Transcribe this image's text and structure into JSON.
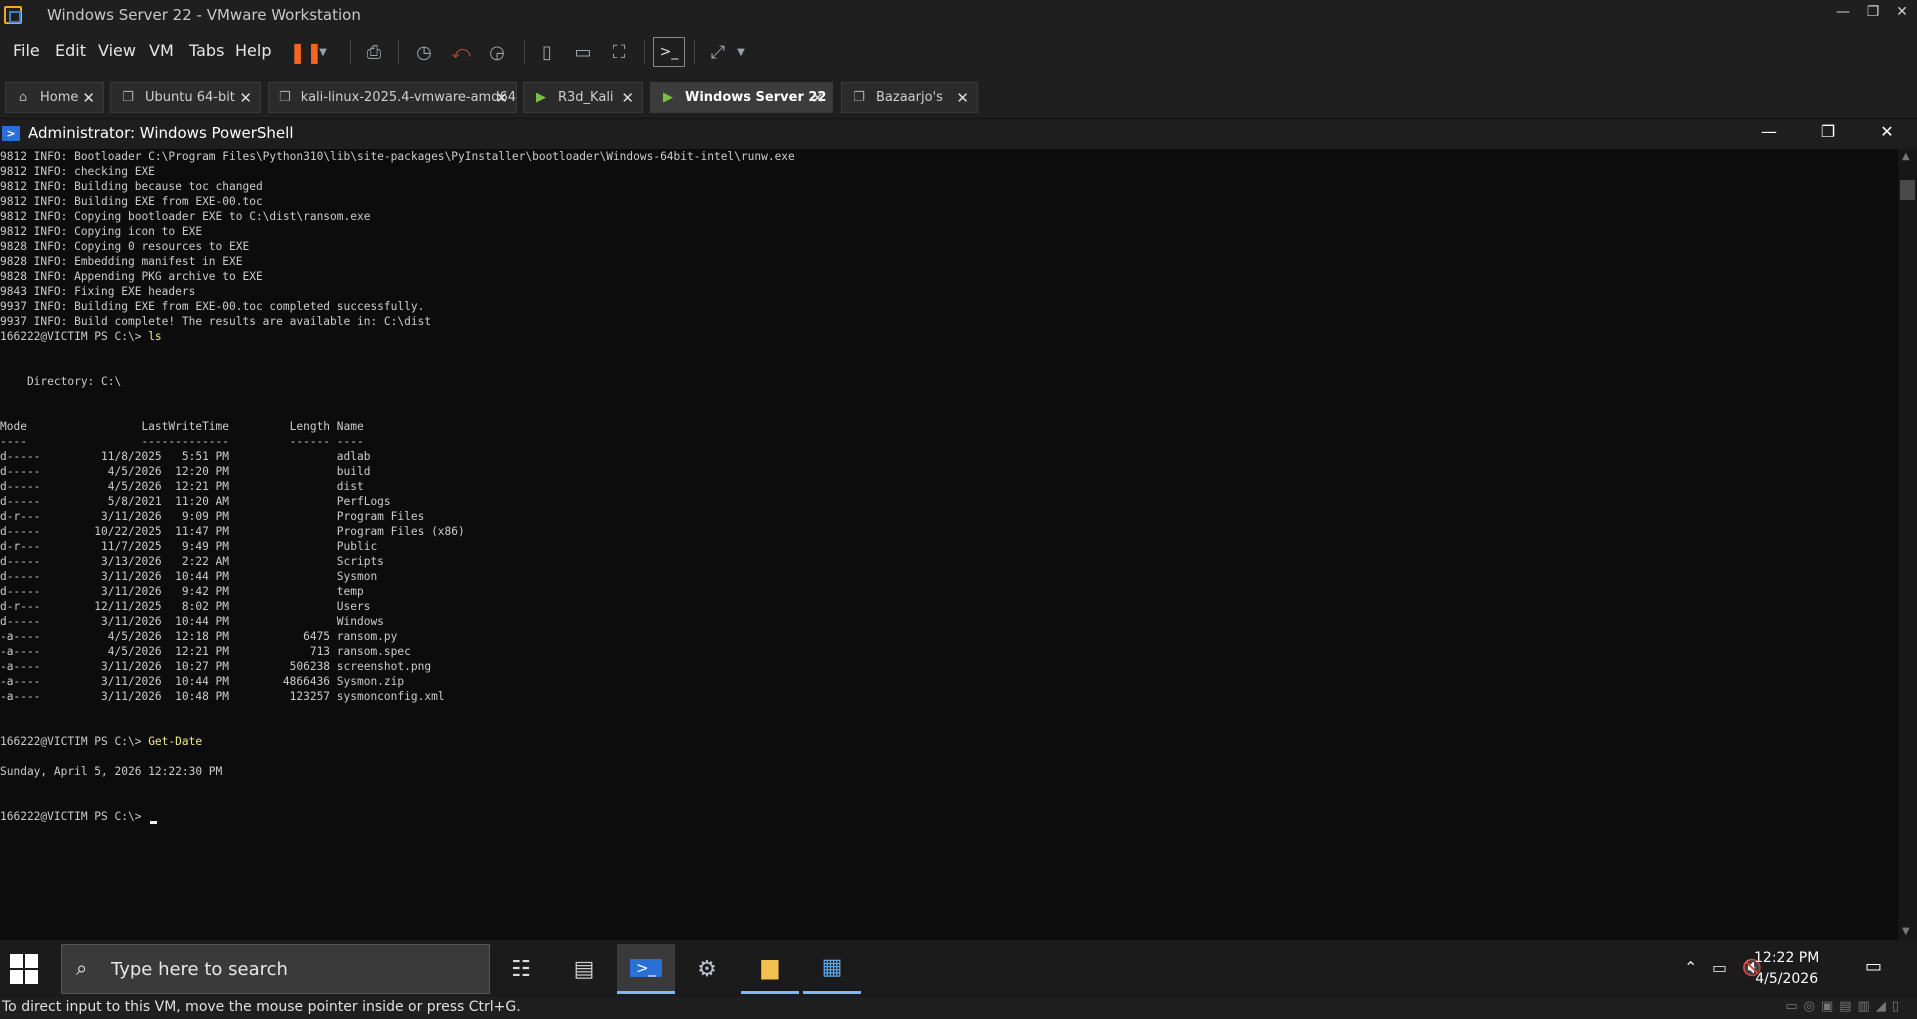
{
  "window": {
    "title": "Windows Server 22 - VMware Workstation",
    "controls": [
      "—",
      "❐",
      "✕"
    ]
  },
  "menu": [
    "File",
    "Edit",
    "View",
    "VM",
    "Tabs",
    "Help"
  ],
  "tabs": [
    {
      "label": "Home",
      "icon": "home-icon"
    },
    {
      "label": "Ubuntu 64-bit",
      "icon": "vm-icon"
    },
    {
      "label": "kali-linux-2025.4-vmware-amd64",
      "icon": "vm-icon"
    },
    {
      "label": "R3d_Kali",
      "icon": "vm-running-icon"
    },
    {
      "label": "Windows Server 22",
      "icon": "vm-running-icon",
      "active": true
    },
    {
      "label": "Bazaarjo's",
      "icon": "vm-icon"
    }
  ],
  "powershell": {
    "title": "Administrator: Windows PowerShell",
    "controls": [
      "—",
      "❐",
      "✕"
    ]
  },
  "console": {
    "build_log": [
      "9812 INFO: Bootloader C:\\Program Files\\Python310\\lib\\site-packages\\PyInstaller\\bootloader\\Windows-64bit-intel\\runw.exe",
      "9812 INFO: checking EXE",
      "9812 INFO: Building because toc changed",
      "9812 INFO: Building EXE from EXE-00.toc",
      "9812 INFO: Copying bootloader EXE to C:\\dist\\ransom.exe",
      "9812 INFO: Copying icon to EXE",
      "9828 INFO: Copying 0 resources to EXE",
      "9828 INFO: Embedding manifest in EXE",
      "9828 INFO: Appending PKG archive to EXE",
      "9843 INFO: Fixing EXE headers",
      "9937 INFO: Building EXE from EXE-00.toc completed successfully.",
      "9937 INFO: Build complete! The results are available in: C:\\dist"
    ],
    "prompt": "166222@VICTIM PS C:\\> ",
    "cmd1": "ls",
    "directory_line": "    Directory: C:\\",
    "listing_header": "Mode                 LastWriteTime         Length Name",
    "listing_rule": "----                 -------------         ------ ----",
    "listing": [
      "d-----         11/8/2025   5:51 PM                adlab",
      "d-----          4/5/2026  12:20 PM                build",
      "d-----          4/5/2026  12:21 PM                dist",
      "d-----          5/8/2021  11:20 AM                PerfLogs",
      "d-r---         3/11/2026   9:09 PM                Program Files",
      "d-----        10/22/2025  11:47 PM                Program Files (x86)",
      "d-r---         11/7/2025   9:49 PM                Public",
      "d-----         3/13/2026   2:22 AM                Scripts",
      "d-----         3/11/2026  10:44 PM                Sysmon",
      "d-----         3/11/2026   9:42 PM                temp",
      "d-r---        12/11/2025   8:02 PM                Users",
      "d-----         3/11/2026  10:44 PM                Windows",
      "-a----          4/5/2026  12:18 PM           6475 ransom.py",
      "-a----          4/5/2026  12:21 PM            713 ransom.spec",
      "-a----         3/11/2026  10:27 PM         506238 screenshot.png",
      "-a----         3/11/2026  10:44 PM        4866436 Sysmon.zip",
      "-a----         3/11/2026  10:48 PM         123257 sysmonconfig.xml"
    ],
    "cmd2": "Get-Date",
    "date_output": "Sunday, April 5, 2026 12:22:30 PM"
  },
  "taskbar": {
    "search_placeholder": "Type here to search",
    "time": "12:22 PM",
    "date": "4/5/2026"
  },
  "statusbar": {
    "text": "To direct input to this VM, move the mouse pointer inside or press Ctrl+G."
  },
  "colors": {
    "console_bg": "#0c0c0c",
    "console_fg": "#cccccc",
    "command": "#f0e68c",
    "pause_accent": "#f26522",
    "taskbar_highlight": "#7fb7ff"
  }
}
